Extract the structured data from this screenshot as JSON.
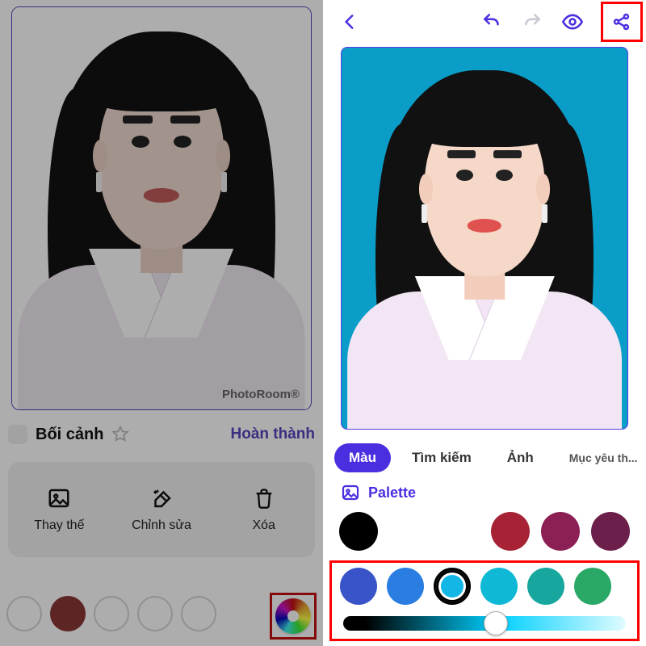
{
  "left": {
    "watermark": "PhotoRoom®",
    "section_title": "Bối cảnh",
    "done_label": "Hoàn thành",
    "tools": {
      "replace": "Thay thế",
      "edit": "Chỉnh sửa",
      "delete": "Xóa"
    },
    "swatches": [
      "#ffffff00",
      "#a62f2f",
      "#ffffff00",
      "#ffffff00",
      "#ffffff00"
    ]
  },
  "right": {
    "tabs": {
      "color": "Màu",
      "search": "Tìm kiếm",
      "image": "Ảnh",
      "favorites": "Mục yêu th..."
    },
    "palette_label": "Palette",
    "row1_colors": [
      "#000000",
      "#a62234",
      "#8c1f53",
      "#6b1f4a"
    ],
    "row2_colors": [
      "#3953c8",
      "#2a7de1",
      "#13b7e6",
      "#0fb8d4",
      "#17a79e",
      "#2aa866"
    ],
    "selected_row2_index": 2,
    "slider_value": 0.54,
    "photo_bg": "#0a9dc7"
  },
  "icons": {
    "back": "back-icon",
    "undo": "undo-icon",
    "redo": "redo-icon",
    "eye": "eye-icon",
    "share": "share-icon",
    "image": "image-icon",
    "sparkle-eraser": "sparkle-eraser-icon",
    "trash": "trash-icon",
    "star": "star-outline-icon",
    "palette": "palette-icon",
    "colorwheel": "colorwheel-icon"
  },
  "accent": "#4a2fe0",
  "highlight_box_color": "#ff0000"
}
